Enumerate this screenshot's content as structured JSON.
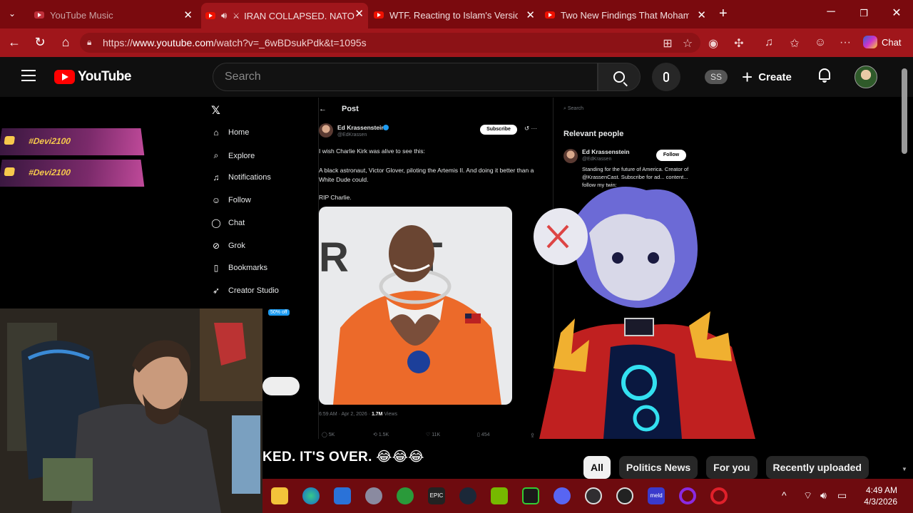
{
  "browser": {
    "tabs": [
      {
        "title": "YouTube Music"
      },
      {
        "title": "IRAN COLLAPSED. NATO"
      },
      {
        "title": "WTF. Reacting to Islam's Version o"
      },
      {
        "title": "Two New Findings That Mohamm"
      }
    ],
    "url_prefix": "https://",
    "url_host": "www.youtube.com",
    "url_path": "/watch?v=_6wBDsukPdk&t=1095s",
    "chat_label": "Chat"
  },
  "youtube": {
    "logo_text": "YouTube",
    "search_placeholder": "Search",
    "avatar_initials": "SS",
    "create_label": "Create"
  },
  "overlay": {
    "handle_1": "#Devi2100",
    "handle_2": "#Devi2100",
    "sale_badge": "50% off"
  },
  "x_sidebar": {
    "items": [
      "Home",
      "Explore",
      "Notifications",
      "Follow",
      "Chat",
      "Grok",
      "Bookmarks",
      "Creator Studio"
    ]
  },
  "post": {
    "header": "Post",
    "author": "Ed Krassenstein",
    "handle": "@EdKrassen",
    "subscribe": "Subscribe",
    "line1": "I wish Charlie Kirk was alive to see this:",
    "line2": "A black astronaut, Victor Glover, piloting the Artemis II. And doing it better than a White Dude could.",
    "line3": "RIP Charlie.",
    "timestamp": "6:59 AM · Apr 2, 2026 · ",
    "views_count": "1.7M",
    "views_label": " Views",
    "bg_letters": "R T E",
    "stats": {
      "replies": "5K",
      "reposts": "1.5K",
      "likes": "11K",
      "bookmarks": "454"
    }
  },
  "right_panel": {
    "search_placeholder": "Search",
    "relevant_title": "Relevant people",
    "person_name": "Ed Krassenstein",
    "person_handle": "@EdKrassen",
    "follow": "Follow",
    "bio": "Standing for the future of America. Creator of @KrassenCast. Subscribe for ad... content... follow my twin:"
  },
  "video": {
    "caption": "KED. IT'S OVER. 😂😂😂"
  },
  "chips": [
    "All",
    "Politics News",
    "For you",
    "Recently uploaded"
  ],
  "taskbar": {
    "time": "4:49 AM",
    "date": "4/3/2026"
  }
}
